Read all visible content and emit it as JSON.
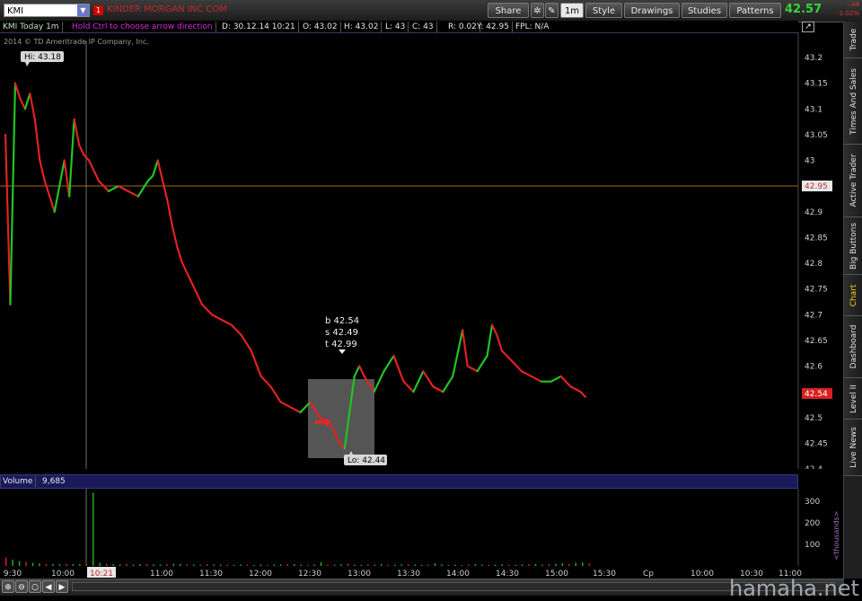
{
  "toolbar": {
    "symbol": "KMI",
    "company": "KINDER MORGAN INC COM",
    "share_label": "Share",
    "interval_label": "1m",
    "style_label": "Style",
    "drawings_label": "Drawings",
    "studies_label": "Studies",
    "patterns_label": "Patterns",
    "last_price": "42.57",
    "change_top": "-.44",
    "change_bottom": "-1.02%"
  },
  "infobar": {
    "title": "KMI Today 1m",
    "hint": "Hold Ctrl to choose arrow direction",
    "date": "D: 30.12.14 10:21",
    "open": "O: 43.02",
    "high": "H: 43.02",
    "low": "L: 43",
    "close": "C: 43",
    "range": "R: 0.02",
    "y": "Y: 42.95",
    "fpl": "FPL: N/A"
  },
  "copyright": "2014 © TD Ameritrade IP Company, Inc.",
  "side_tabs": [
    "Trade",
    "Times And Sales",
    "Active Trader",
    "Big Buttons",
    "Chart",
    "Dashboard",
    "Level II",
    "Live News"
  ],
  "active_tab": "Chart",
  "chart_data": {
    "type": "line",
    "price_axis_ticks": [
      "43.2",
      "43.15",
      "43.1",
      "43.05",
      "43",
      "42.95",
      "42.9",
      "42.85",
      "42.8",
      "42.75",
      "42.7",
      "42.65",
      "42.6",
      "42.55",
      "42.5",
      "42.45",
      "42.4"
    ],
    "ylim": [
      42.4,
      43.2
    ],
    "hi_label": "Hi: 43.18",
    "lo_label": "Lo: 42.44",
    "crosshair_price": "42.95",
    "last_price_label": "42.54",
    "bubble": {
      "b": "b 42.54",
      "s": "s 42.49",
      "t": "t 42.99"
    },
    "price_series": [
      [
        "9:30",
        43.05
      ],
      [
        "9:33",
        42.72
      ],
      [
        "9:36",
        43.15
      ],
      [
        "9:39",
        43.12
      ],
      [
        "9:42",
        43.1
      ],
      [
        "9:45",
        43.13
      ],
      [
        "9:48",
        43.08
      ],
      [
        "9:51",
        43.0
      ],
      [
        "9:54",
        42.96
      ],
      [
        "9:57",
        42.93
      ],
      [
        "10:00",
        42.9
      ],
      [
        "10:03",
        42.95
      ],
      [
        "10:06",
        43.0
      ],
      [
        "10:09",
        42.93
      ],
      [
        "10:12",
        43.08
      ],
      [
        "10:15",
        43.03
      ],
      [
        "10:18",
        43.01
      ],
      [
        "10:21",
        43.0
      ],
      [
        "10:27",
        42.96
      ],
      [
        "10:33",
        42.94
      ],
      [
        "10:39",
        42.95
      ],
      [
        "10:45",
        42.94
      ],
      [
        "10:51",
        42.93
      ],
      [
        "10:57",
        42.96
      ],
      [
        "11:00",
        42.97
      ],
      [
        "11:03",
        43.0
      ],
      [
        "11:06",
        42.96
      ],
      [
        "11:09",
        42.92
      ],
      [
        "11:12",
        42.87
      ],
      [
        "11:15",
        42.83
      ],
      [
        "11:18",
        42.8
      ],
      [
        "11:21",
        42.78
      ],
      [
        "11:24",
        42.76
      ],
      [
        "11:27",
        42.74
      ],
      [
        "11:30",
        42.72
      ],
      [
        "11:36",
        42.7
      ],
      [
        "11:42",
        42.69
      ],
      [
        "11:48",
        42.68
      ],
      [
        "11:54",
        42.66
      ],
      [
        "12:00",
        42.63
      ],
      [
        "12:06",
        42.58
      ],
      [
        "12:12",
        42.56
      ],
      [
        "12:18",
        42.53
      ],
      [
        "12:24",
        42.52
      ],
      [
        "12:30",
        42.51
      ],
      [
        "12:36",
        42.53
      ],
      [
        "12:42",
        42.5
      ],
      [
        "12:48",
        42.49
      ],
      [
        "12:54",
        42.45
      ],
      [
        "12:57",
        42.44
      ],
      [
        "13:00",
        42.51
      ],
      [
        "13:03",
        42.58
      ],
      [
        "13:06",
        42.6
      ],
      [
        "13:09",
        42.58
      ],
      [
        "13:15",
        42.55
      ],
      [
        "13:21",
        42.59
      ],
      [
        "13:27",
        42.62
      ],
      [
        "13:33",
        42.57
      ],
      [
        "13:39",
        42.55
      ],
      [
        "13:45",
        42.59
      ],
      [
        "13:51",
        42.56
      ],
      [
        "13:57",
        42.55
      ],
      [
        "14:03",
        42.58
      ],
      [
        "14:09",
        42.67
      ],
      [
        "14:12",
        42.6
      ],
      [
        "14:18",
        42.59
      ],
      [
        "14:24",
        42.62
      ],
      [
        "14:27",
        42.68
      ],
      [
        "14:30",
        42.66
      ],
      [
        "14:33",
        42.63
      ],
      [
        "14:39",
        42.61
      ],
      [
        "14:45",
        42.59
      ],
      [
        "14:51",
        42.58
      ],
      [
        "14:57",
        42.57
      ],
      [
        "15:03",
        42.57
      ],
      [
        "15:09",
        42.58
      ],
      [
        "15:15",
        42.56
      ],
      [
        "15:21",
        42.55
      ],
      [
        "15:24",
        42.54
      ]
    ],
    "time_axis_labels": [
      "9:30",
      "10:00",
      "10:21",
      "11:00",
      "11:30",
      "12:00",
      "12:30",
      "13:00",
      "13:30",
      "14:00",
      "14:30",
      "15:00",
      "15:30",
      "Cp",
      "10:00",
      "10:30",
      "11:00"
    ],
    "volume_label": "Volume",
    "volume_value": "9,685",
    "volume_axis_ticks": [
      "300",
      "200",
      "100"
    ],
    "volume_unit": "<thousands>",
    "volume_series": [
      40,
      30,
      22,
      18,
      15,
      12,
      10,
      9,
      8,
      9,
      8,
      8,
      7,
      340,
      14,
      9,
      8,
      7,
      10,
      6,
      8,
      9,
      7,
      6,
      8,
      10,
      9,
      7,
      6,
      5,
      8,
      7,
      6,
      6,
      5,
      7,
      6,
      5,
      6,
      5,
      6,
      7,
      9,
      8,
      6,
      5,
      7,
      18,
      6,
      5,
      8,
      10,
      6,
      5,
      7,
      6,
      9,
      5,
      6,
      7,
      8,
      6,
      5,
      6,
      12,
      7,
      5,
      6,
      4,
      7,
      8,
      6,
      5,
      6,
      7,
      6,
      5,
      7,
      8,
      9,
      6,
      8,
      10,
      12,
      9,
      14,
      16,
      11
    ]
  },
  "watermark": "hamaha.net"
}
